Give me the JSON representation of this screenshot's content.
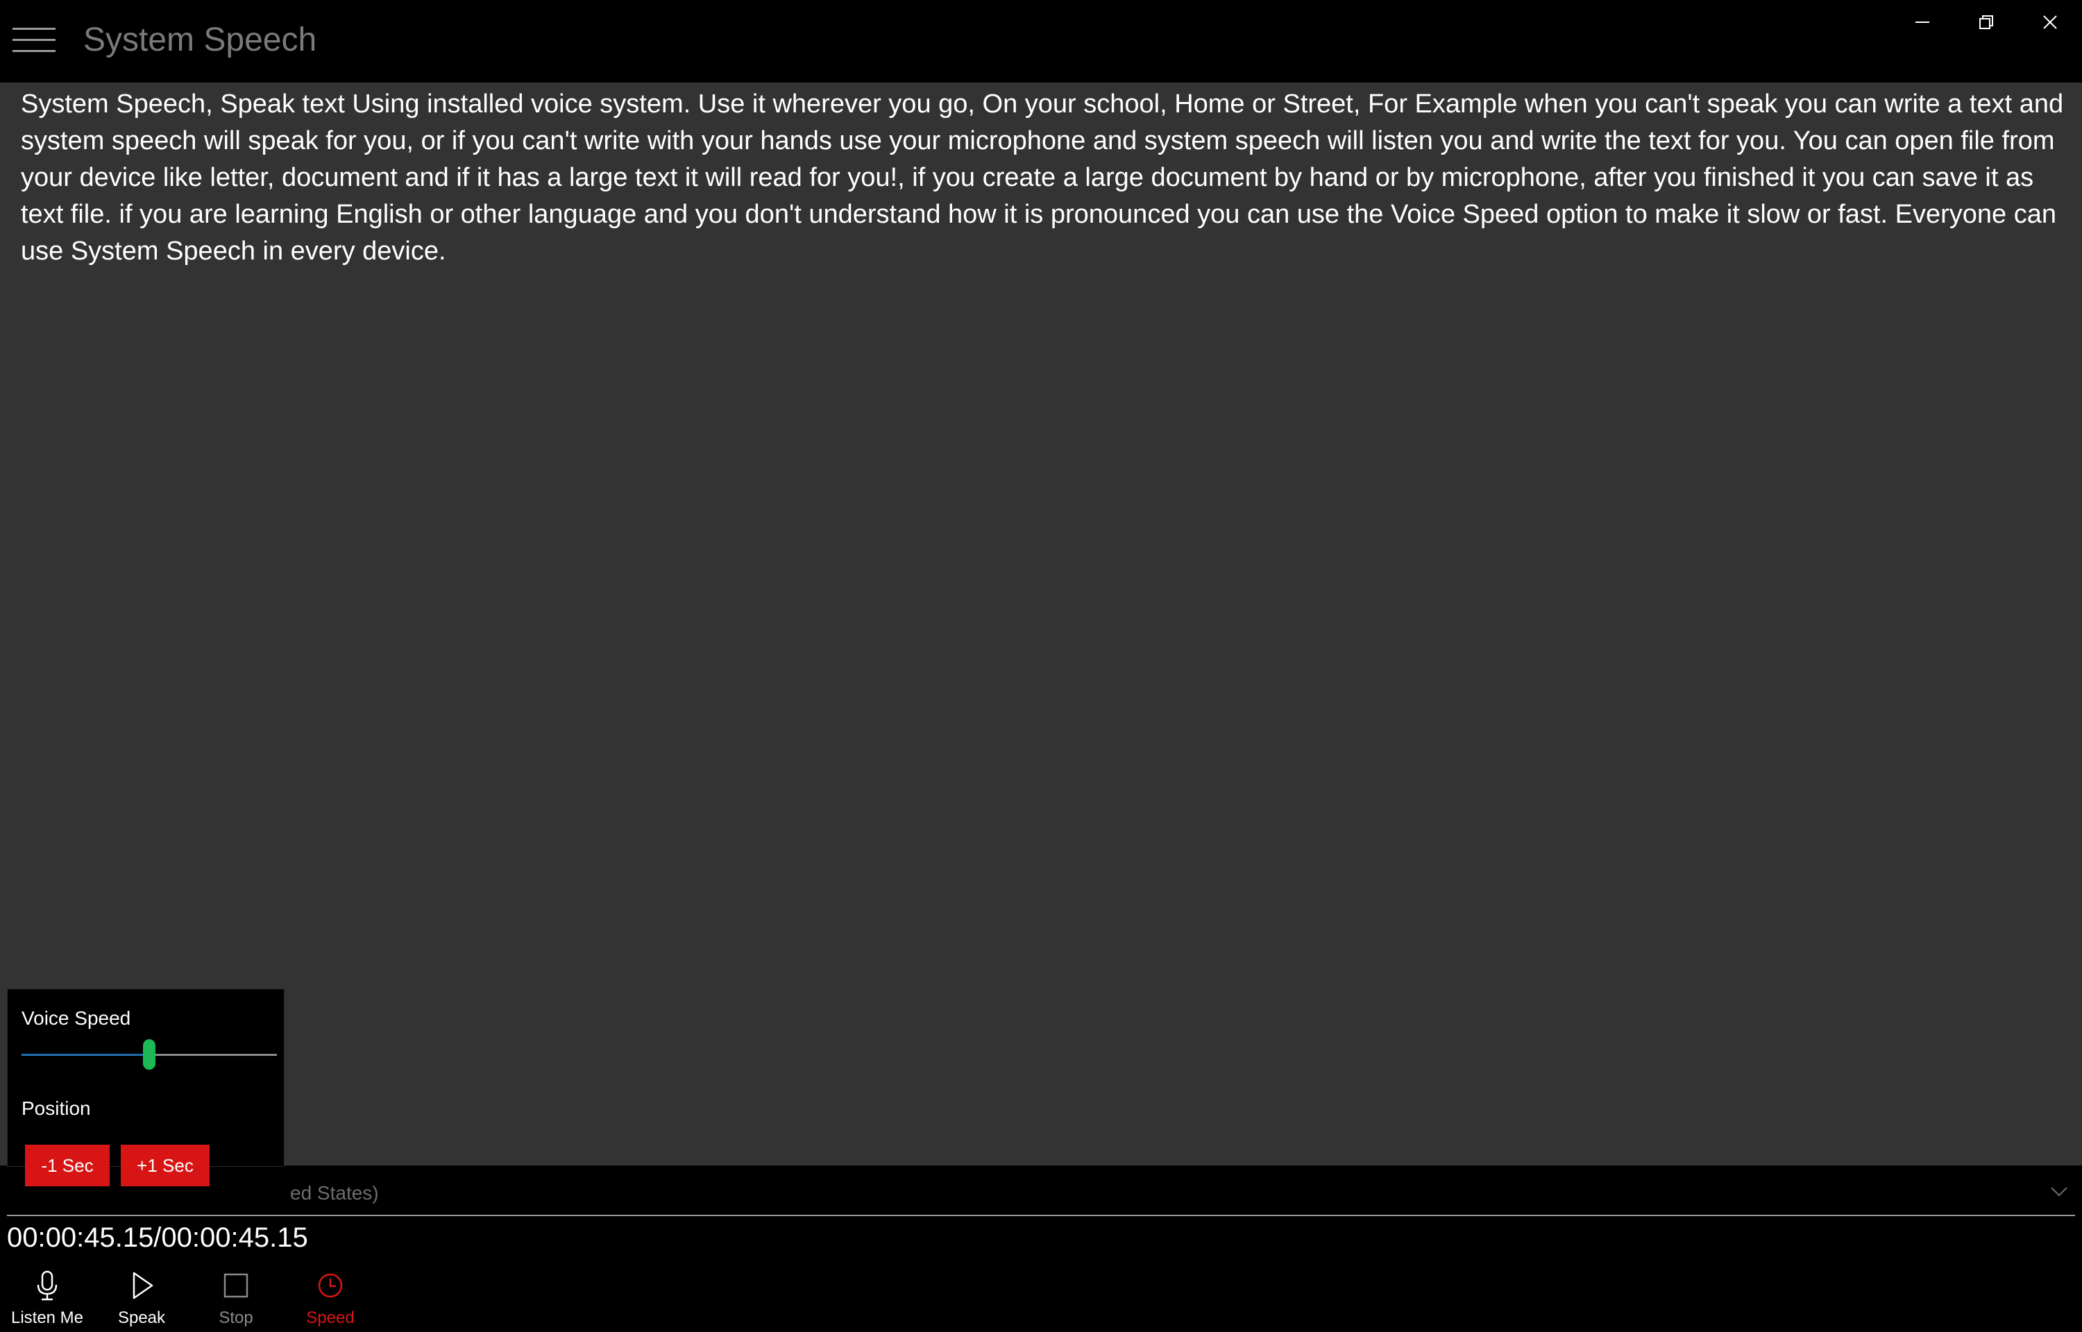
{
  "app": {
    "title": "System Speech"
  },
  "window_controls": {
    "minimize": "minimize-icon",
    "restore": "restore-icon",
    "close": "close-icon"
  },
  "main": {
    "text": "System Speech, Speak text Using installed voice system. Use it wherever you go, On your school, Home or Street, For Example when you can't speak you can write a text and system speech will speak for you, or if you can't write with your hands use your microphone and system speech will listen you and write the text for you. You can open file from your device like letter, document and if it has a large text it will read for you!, if you create a large document by hand or by microphone, after you finished it you can save it as text file. if you are learning English or other language and you don't understand how it is pronounced you can use the Voice Speed option to make it slow or fast. Everyone can use System Speech in every device."
  },
  "flyout": {
    "voice_speed_label": "Voice Speed",
    "voice_speed_value": 0.5,
    "position_label": "Position",
    "minus_button": "-1 Sec",
    "plus_button": "+1 Sec"
  },
  "voice_select": {
    "visible_text": "ed States)"
  },
  "playback": {
    "timecode": "00:00:45.15/00:00:45.15"
  },
  "commands": [
    {
      "label": "Listen Me",
      "icon": "microphone-icon"
    },
    {
      "label": "Speak",
      "icon": "play-icon"
    },
    {
      "label": "Stop",
      "icon": "stop-icon"
    },
    {
      "label": "Speed",
      "icon": "clock-icon"
    }
  ],
  "colors": {
    "accent_red": "#d81515",
    "slider_thumb": "#1db954",
    "slider_fill": "#1f6fb0",
    "disabled": "#8a8a8a"
  }
}
